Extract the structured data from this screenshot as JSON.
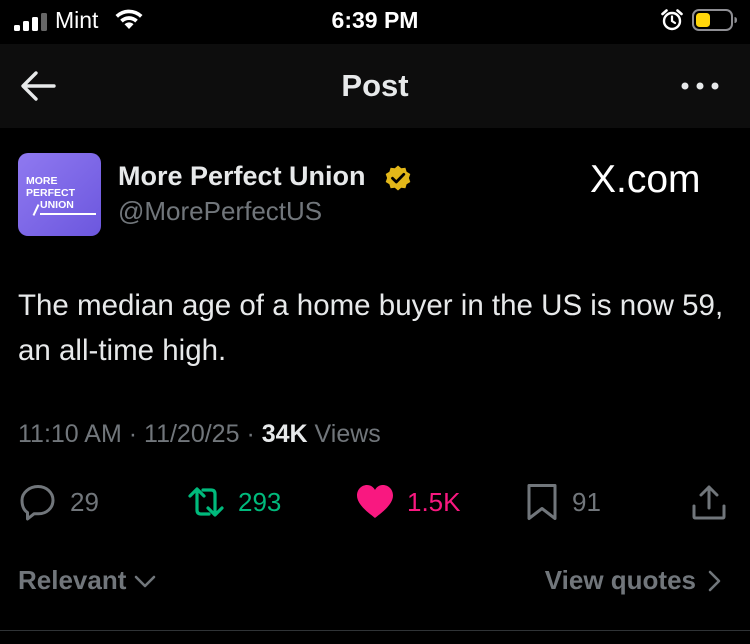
{
  "status_bar": {
    "carrier": "Mint",
    "time": "6:39 PM",
    "icons": [
      "signal-icon",
      "wifi-icon",
      "alarm-icon",
      "battery-icon"
    ]
  },
  "header": {
    "title": "Post",
    "back_icon": "arrow-left-icon",
    "more_icon": "more-horizontal-icon"
  },
  "post": {
    "avatar_text": [
      "MORE",
      "PERFECT",
      "UNION"
    ],
    "display_name": "More Perfect Union",
    "verified": true,
    "handle": "@MorePerfectUS",
    "brand_watermark": "X.com",
    "text": "The median age of a home buyer in the US is now 59, an all-time high.",
    "time": "11:10 AM",
    "date": "11/20/25",
    "separator": "·",
    "views_count": "34K",
    "views_label": "Views"
  },
  "actions": {
    "replies": "29",
    "reposts": "293",
    "likes": "1.5K",
    "bookmarks": "91"
  },
  "footer": {
    "sort_label": "Relevant",
    "quotes_label": "View quotes"
  },
  "colors": {
    "background": "#000000",
    "text": "#e7e9ea",
    "muted": "#71767b",
    "repost_green": "#00ba7c",
    "like_pink": "#f91880",
    "avatar_purple": "#7b66e8",
    "verified_gold": "#e2b719"
  }
}
